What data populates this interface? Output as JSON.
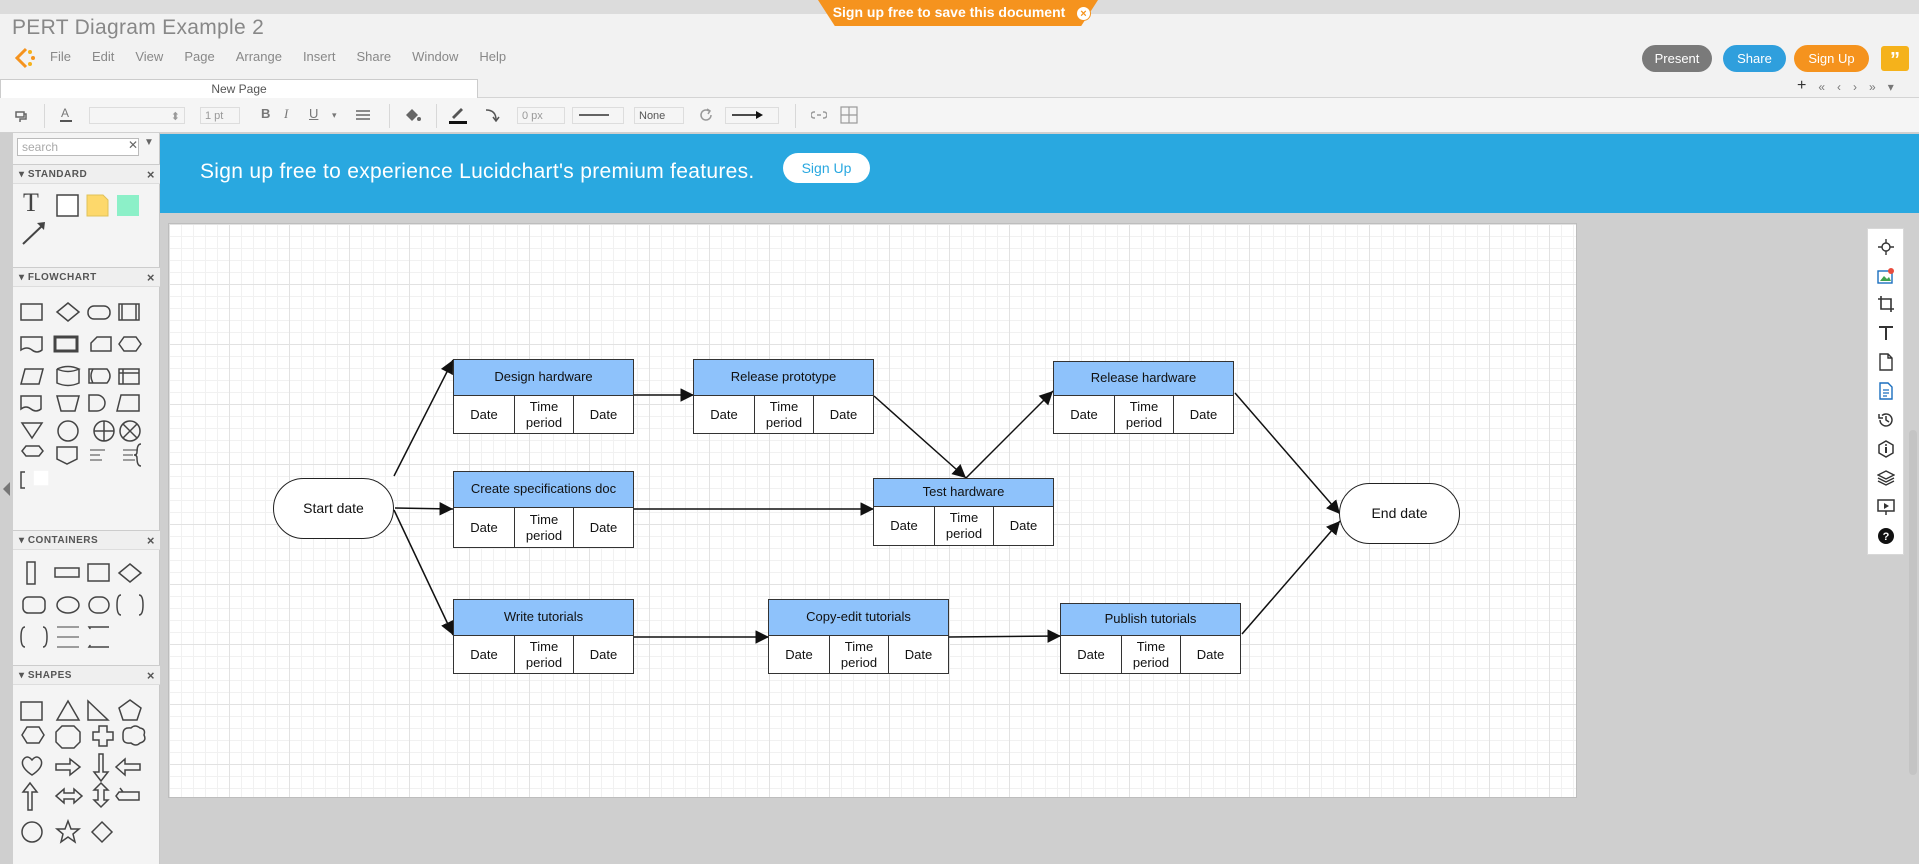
{
  "app": {
    "title": "PERT Diagram Example 2",
    "save_banner": "Sign up free to save this document",
    "menu": [
      "File",
      "Edit",
      "View",
      "Page",
      "Arrange",
      "Insert",
      "Share",
      "Window",
      "Help"
    ],
    "buttons": {
      "present": "Present",
      "share": "Share",
      "signup": "Sign Up",
      "feedback": "”"
    },
    "page_tab": "New Page"
  },
  "toolbar": {
    "line_width": "1 pt",
    "stroke_width": "0 px",
    "arrow_start": "None"
  },
  "sidebar": {
    "search_placeholder": "search",
    "sections": [
      "STANDARD",
      "FLOWCHART",
      "CONTAINERS",
      "SHAPES"
    ]
  },
  "promo": {
    "text": "Sign up free to experience Lucidchart's premium features.",
    "button": "Sign Up"
  },
  "diagram": {
    "start": "Start date",
    "end": "End date",
    "cells": {
      "left": "Date",
      "mid": "Time period",
      "right": "Date"
    },
    "tasks": {
      "design_hardware": "Design hardware",
      "release_prototype": "Release prototype",
      "release_hardware": "Release hardware",
      "create_specs": "Create specifications doc",
      "test_hardware": "Test hardware",
      "write_tutorials": "Write tutorials",
      "copy_edit": "Copy-edit tutorials",
      "publish_tutorials": "Publish tutorials"
    }
  },
  "colors": {
    "task_header": "#8ec2fb",
    "promo_blue": "#29a8e0",
    "accent_orange": "#f5931e"
  }
}
